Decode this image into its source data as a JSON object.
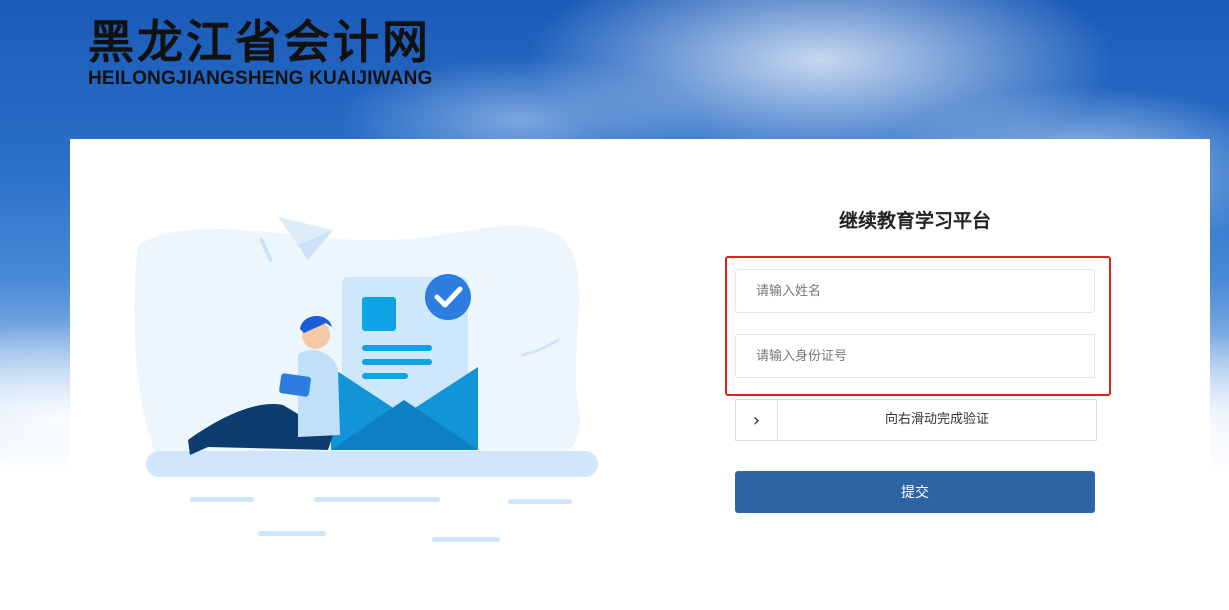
{
  "header": {
    "logo_cn": "黑龙江省会计网",
    "logo_en": "HEILONGJIANGSHENG KUAIJIWANG"
  },
  "form": {
    "title": "继续教育学习平台",
    "name_placeholder": "请输入姓名",
    "id_placeholder": "请输入身份证号",
    "slider_text": "向右滑动完成验证",
    "slider_icon": "chevron-right-icon",
    "submit_label": "提交"
  },
  "colors": {
    "primary": "#2d64a3",
    "highlight": "#e0241b",
    "illustration_accent": "#0ea2e6"
  }
}
